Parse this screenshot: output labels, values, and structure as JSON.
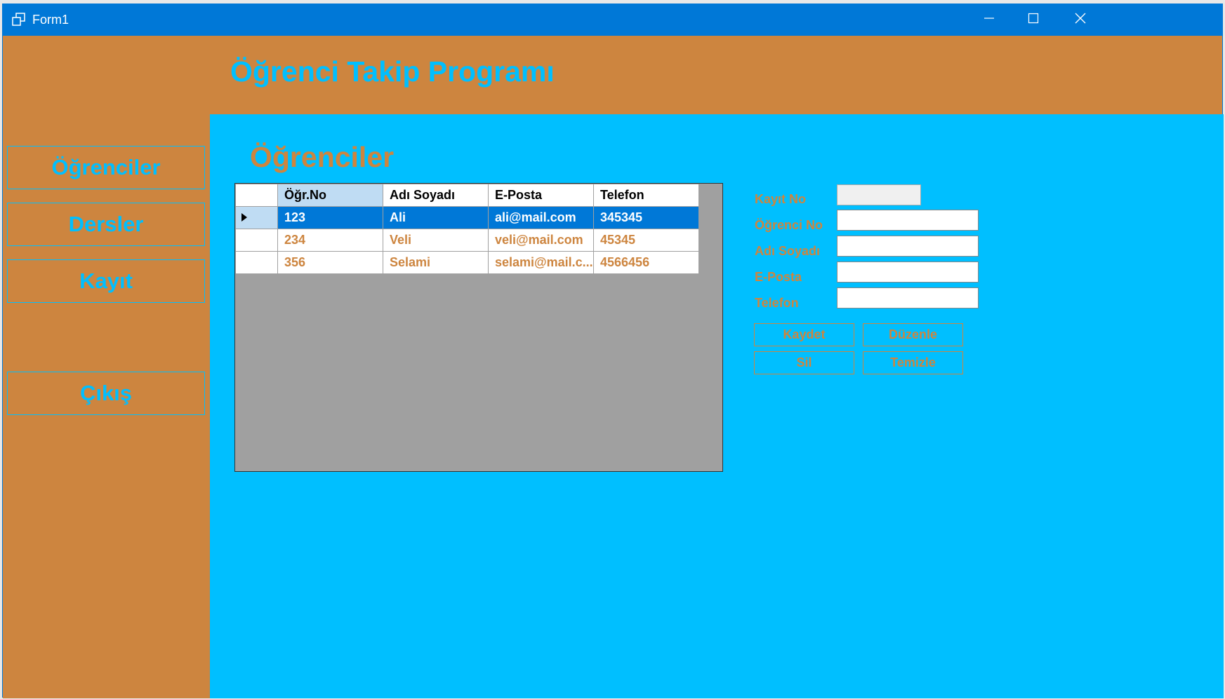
{
  "window": {
    "title": "Form1",
    "minimize_icon": "minimize-icon",
    "maximize_icon": "maximize-icon",
    "close_icon": "close-icon"
  },
  "header": {
    "title": "Öğrenci Takip Programı"
  },
  "sidebar": {
    "items": [
      {
        "label": "Öğrenciler"
      },
      {
        "label": "Dersler"
      },
      {
        "label": "Kayıt"
      },
      {
        "label": "Çıkış"
      }
    ]
  },
  "main": {
    "section_title": "Öğrenciler",
    "grid": {
      "columns": [
        "Öğr.No",
        "Adı Soyadı",
        "E-Posta",
        "Telefon"
      ],
      "rows": [
        {
          "no": "123",
          "name": "Ali",
          "email": "ali@mail.com",
          "phone": "345345",
          "selected": true
        },
        {
          "no": "234",
          "name": "Veli",
          "email": "veli@mail.com",
          "phone": "45345",
          "selected": false
        },
        {
          "no": "356",
          "name": "Selami",
          "email": "selami@mail.c...",
          "phone": "4566456",
          "selected": false
        }
      ]
    },
    "form": {
      "labels": {
        "kayit_no": "Kayıt No",
        "ogrenci_no": "Öğrenci No",
        "adi_soyadi": "Adı Soyadı",
        "eposta": "E-Posta",
        "telefon": "Telefon"
      },
      "values": {
        "kayit_no": "",
        "ogrenci_no": "",
        "adi_soyadi": "",
        "eposta": "",
        "telefon": ""
      },
      "buttons": {
        "save": "Kaydet",
        "edit": "Düzenle",
        "delete": "Sil",
        "clear": "Temizle"
      }
    }
  },
  "colors": {
    "brand_orange": "#cd853f",
    "accent_cyan": "#00bfff",
    "titlebar_blue": "#0078d7"
  }
}
